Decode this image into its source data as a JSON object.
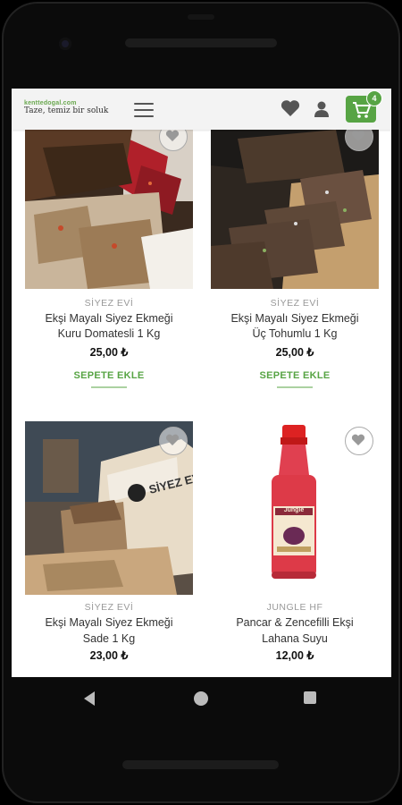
{
  "header": {
    "domain": "kenttedogal.com",
    "slogan": "Taze, temiz bir soluk",
    "cart_count": "4"
  },
  "products": [
    {
      "brand": "SİYEZ EVİ",
      "name_line1": "Ekşi Mayalı Siyez Ekmeği",
      "name_line2": "Kuru Domatesli 1 Kg",
      "price": "25,00 ₺",
      "add_to_cart": "SEPETE EKLE"
    },
    {
      "brand": "SİYEZ EVİ",
      "name_line1": "Ekşi Mayalı Siyez Ekmeği",
      "name_line2": "Üç Tohumlu 1 Kg",
      "price": "25,00 ₺",
      "add_to_cart": "SEPETE EKLE"
    },
    {
      "brand": "SİYEZ EVİ",
      "name_line1": "Ekşi Mayalı Siyez Ekmeği",
      "name_line2": "Sade 1 Kg",
      "price": "23,00 ₺",
      "package_label": "SİYEZ EV"
    },
    {
      "brand": "JUNGLE HF",
      "name_line1": "Pancar & Zencefilli Ekşi",
      "name_line2": "Lahana Suyu",
      "price": "12,00 ₺",
      "bottle_label": "Jungle"
    }
  ],
  "colors": {
    "accent": "#57a444",
    "header_bg": "#f3f3f3"
  },
  "icons": [
    "wishlist-heart-icon",
    "user-icon",
    "cart-icon",
    "hamburger-menu-icon",
    "back-icon",
    "home-icon",
    "recents-icon"
  ]
}
